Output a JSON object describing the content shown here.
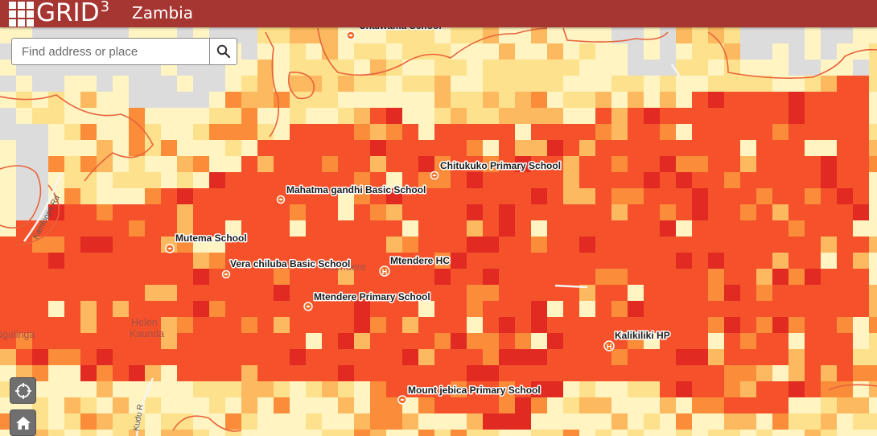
{
  "header": {
    "brand": "GRID",
    "brand_sup": "3",
    "country": "Zambia"
  },
  "search": {
    "placeholder": "Find address or place",
    "value": ""
  },
  "controls": {
    "locate_icon": "crosshair-icon",
    "home_icon": "home-icon"
  },
  "colors": {
    "header": "#a63632",
    "level1": "#fff4c2",
    "level2": "#fee18c",
    "level3": "#fdb95f",
    "level4": "#fa8c3a",
    "level5": "#f5512b",
    "level6": "#e02a22",
    "level7": "#cb1a1d",
    "boundary": "#e8633c",
    "background": "#dcdcdc"
  },
  "map_labels": {
    "schools": [
      "Chitukuko Primary School",
      "Mahatma gandhi Basic School",
      "Mutema School",
      "Vera chiluba Basic School",
      "Mtendere Primary School",
      "Mount jebica Primary School",
      "Chaiwama School"
    ],
    "health": [
      "Mtendere HC",
      "Kalikiliki HP"
    ],
    "places": [
      "Mtendere",
      "Helen",
      "Kaunda",
      "Ngalinga"
    ],
    "roads": [
      "Kamloops Rd",
      "Kudu R"
    ]
  }
}
